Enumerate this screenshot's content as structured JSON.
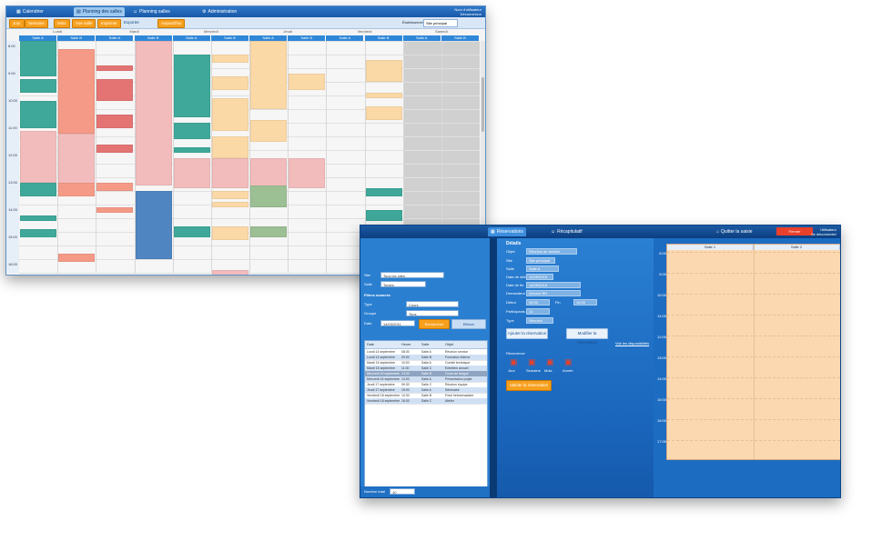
{
  "calendar": {
    "tabs": [
      "Calendrier",
      "Planning des salles",
      "Planning salles",
      "Administration"
    ],
    "active_tab": 1,
    "user": {
      "name": "Nom d'utilisateur",
      "action": "Déconnexion"
    },
    "toolbar_buttons": [
      "Jour",
      "Semaine",
      "Mois",
      "Vue salle",
      "Imprimer",
      "Exporter",
      "Aujourd'hui"
    ],
    "establishment_label": "Établissement",
    "establishment_value": "Site principal",
    "days": [
      "Lundi",
      "Mardi",
      "Mercredi",
      "Jeudi",
      "Vendredi",
      "Samedi"
    ],
    "rooms": [
      "Salle A",
      "Salle B"
    ],
    "times": [
      "8:00",
      "9:00",
      "10:00",
      "11:00",
      "12:00",
      "13:00",
      "14:00",
      "15:00",
      "16:00",
      "17:00"
    ]
  },
  "booking": {
    "tabs": [
      "Réservations",
      "Récapitulatif",
      "Quitter la saisie"
    ],
    "close_label": "Fermer",
    "user": {
      "name": "Utilisateur",
      "action": "Se déconnecter"
    },
    "search": {
      "site_label": "Site",
      "site_value": "Tous les sites",
      "room_label": "Salle",
      "room_value": "Toutes",
      "filter_title": "Filtres avancés",
      "type_label": "Type",
      "type_value": "Cours",
      "group_label": "Groupe",
      "group_value": "Tous",
      "date_label": "Date",
      "date_value": "14/03/2011",
      "search_button": "Rechercher",
      "reset_button": "Effacer",
      "list_headers": [
        "Date",
        "Heure",
        "Salle",
        "Objet"
      ],
      "list_rows": [
        [
          "Lundi 14 septembre",
          "08:30",
          "Salle A",
          "Réunion service"
        ],
        [
          "Lundi 14 septembre",
          "09:00",
          "Salle B",
          "Formation interne"
        ],
        [
          "Mardi 15 septembre",
          "10:00",
          "Salle A",
          "Comité technique"
        ],
        [
          "Mardi 15 septembre",
          "11:00",
          "Salle C",
          "Entretien annuel"
        ],
        [
          "Mercredi 16 septembre",
          "13:30",
          "Salle B",
          "Cours de langue"
        ],
        [
          "Mercredi 16 septembre",
          "14:00",
          "Salle A",
          "Présentation projet"
        ],
        [
          "Jeudi 17 septembre",
          "09:30",
          "Salle C",
          "Réunion équipe"
        ],
        [
          "Jeudi 17 septembre",
          "15:00",
          "Salle A",
          "Séminaire"
        ],
        [
          "Vendredi 18 septembre",
          "10:30",
          "Salle B",
          "Point hebdomadaire"
        ],
        [
          "Vendredi 18 septembre",
          "16:00",
          "Salle C",
          "Atelier"
        ]
      ],
      "footer_label": "Nombre total",
      "footer_value": "10"
    },
    "form": {
      "title": "Détails",
      "fields": [
        {
          "label": "Objet",
          "value": "Réunion de service"
        },
        {
          "label": "Site",
          "value": "Site principal"
        },
        {
          "label": "Salle",
          "value": "Salle A"
        },
        {
          "label": "Date de début",
          "value": "14/09/2015"
        },
        {
          "label": "Date de fin",
          "value": "14/09/2015"
        },
        {
          "label": "Demandeur",
          "value": "Service RH"
        },
        {
          "label": "Début",
          "value": "08:30"
        },
        {
          "label": "Fin",
          "value": "10:00"
        },
        {
          "label": "Participants",
          "value": "12"
        },
        {
          "label": "Type",
          "value": "Réunion"
        }
      ],
      "add_button": "Ajouter la réservation",
      "modify_button": "Modifier la réservation",
      "link_text": "Voir les disponibilités",
      "recurrence_title": "Récurrence",
      "recurrence_options": [
        "Jour",
        "Semaine",
        "Mois",
        "Année"
      ],
      "validate_button": "Valider la réservation"
    },
    "grid": {
      "rooms": [
        "Salle 1",
        "Salle 2"
      ],
      "times": [
        "8:00",
        "9:00",
        "10:00",
        "11:00",
        "12:00",
        "13:00",
        "14:00",
        "15:00",
        "16:00",
        "17:00"
      ]
    }
  },
  "colors": {
    "accent": "#1a6ec4",
    "orange": "#f7a01e",
    "teal": "#3fa89a",
    "peach": "#fbd8b0",
    "close": "#e8402a"
  }
}
